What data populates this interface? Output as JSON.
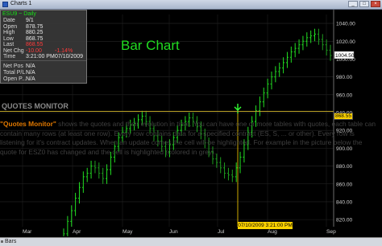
{
  "window": {
    "title": "Charts 1"
  },
  "data_window": {
    "header": "ESU9 ~ Daily",
    "rows": [
      {
        "label": "Date",
        "value": "9/1",
        "red": false
      },
      {
        "label": "Open",
        "value": "878.75",
        "red": false
      },
      {
        "label": "High",
        "value": "880.25",
        "red": false
      },
      {
        "label": "Low",
        "value": "868.75",
        "red": false
      },
      {
        "label": "Last",
        "value": "868.55",
        "red": true
      },
      {
        "label": "Net Chg",
        "value": "-10.00",
        "red": true,
        "extra": "-1.14%"
      },
      {
        "label": "Time",
        "value": "3:21:00 PM",
        "red": false,
        "extra2": "07/10/2009"
      }
    ],
    "pos_rows": [
      {
        "label": "Net Pos",
        "value": "N/A"
      },
      {
        "label": "Total P/L",
        "value": "N/A"
      },
      {
        "label": "Open P...",
        "value": "N/A"
      }
    ]
  },
  "chart_title": "Bar Chart",
  "quotes_monitor": {
    "title": "QUOTES MONITOR",
    "highlight": "\"Quotes Monitor\"",
    "body": " shows the quotes and their evolution in time. You can have one or more tables with quotes, each table can contain many rows (at least one row). Every row contains data for a specified contract (ES, S, ... or other). Every row is listening for it's contract updates. When an update comes the cell will be highlighted. For example in the picture below the quote for ESZ0 has changed and the cell is highlighted (colored in grey)."
  },
  "crosshair": {
    "price_label": "868.55",
    "date_label": "07/10/2009 3:21:00 PM"
  },
  "status_bar": {
    "tab": "Bars"
  },
  "colors": {
    "bar": "#22cc22",
    "background": "#000000",
    "crosshair": "#ffd400",
    "text_highlight": "#e07800"
  },
  "chart_data": {
    "type": "bar",
    "y_ticks": [
      820,
      840,
      860,
      880,
      900,
      920,
      940,
      960,
      980,
      1000,
      1020,
      1040
    ],
    "y_tick_labels": [
      "820.00",
      "840.00",
      "860.00",
      "880.00",
      "900.00",
      "920.00",
      "940.00",
      "960.00",
      "980.00",
      "1000.00",
      "1020.00",
      "1040.00"
    ],
    "ylim": [
      812,
      1050
    ],
    "x_labels": [
      "Mar",
      "Apr",
      "May",
      "Jun",
      "Jul",
      "Aug",
      "Sep"
    ],
    "last_price_label": "1004.50",
    "series_close": [
      735,
      730,
      718,
      704,
      698,
      690,
      688,
      698,
      712,
      726,
      740,
      752,
      764,
      776,
      790,
      804,
      818,
      830,
      844,
      856,
      868,
      872,
      880,
      878,
      872,
      866,
      876,
      890,
      902,
      912,
      918,
      922,
      926,
      928,
      932,
      936,
      930,
      922,
      914,
      908,
      902,
      896,
      904,
      912,
      920,
      926,
      930,
      934,
      930,
      924,
      916,
      906,
      896,
      888,
      884,
      878,
      872,
      870,
      868,
      878,
      890,
      904,
      918,
      930,
      942,
      952,
      962,
      972,
      980,
      986,
      990,
      996,
      1002,
      1008,
      1012,
      1016,
      1020,
      1024,
      1026,
      1028,
      1022,
      1016,
      1010,
      1004
    ]
  }
}
